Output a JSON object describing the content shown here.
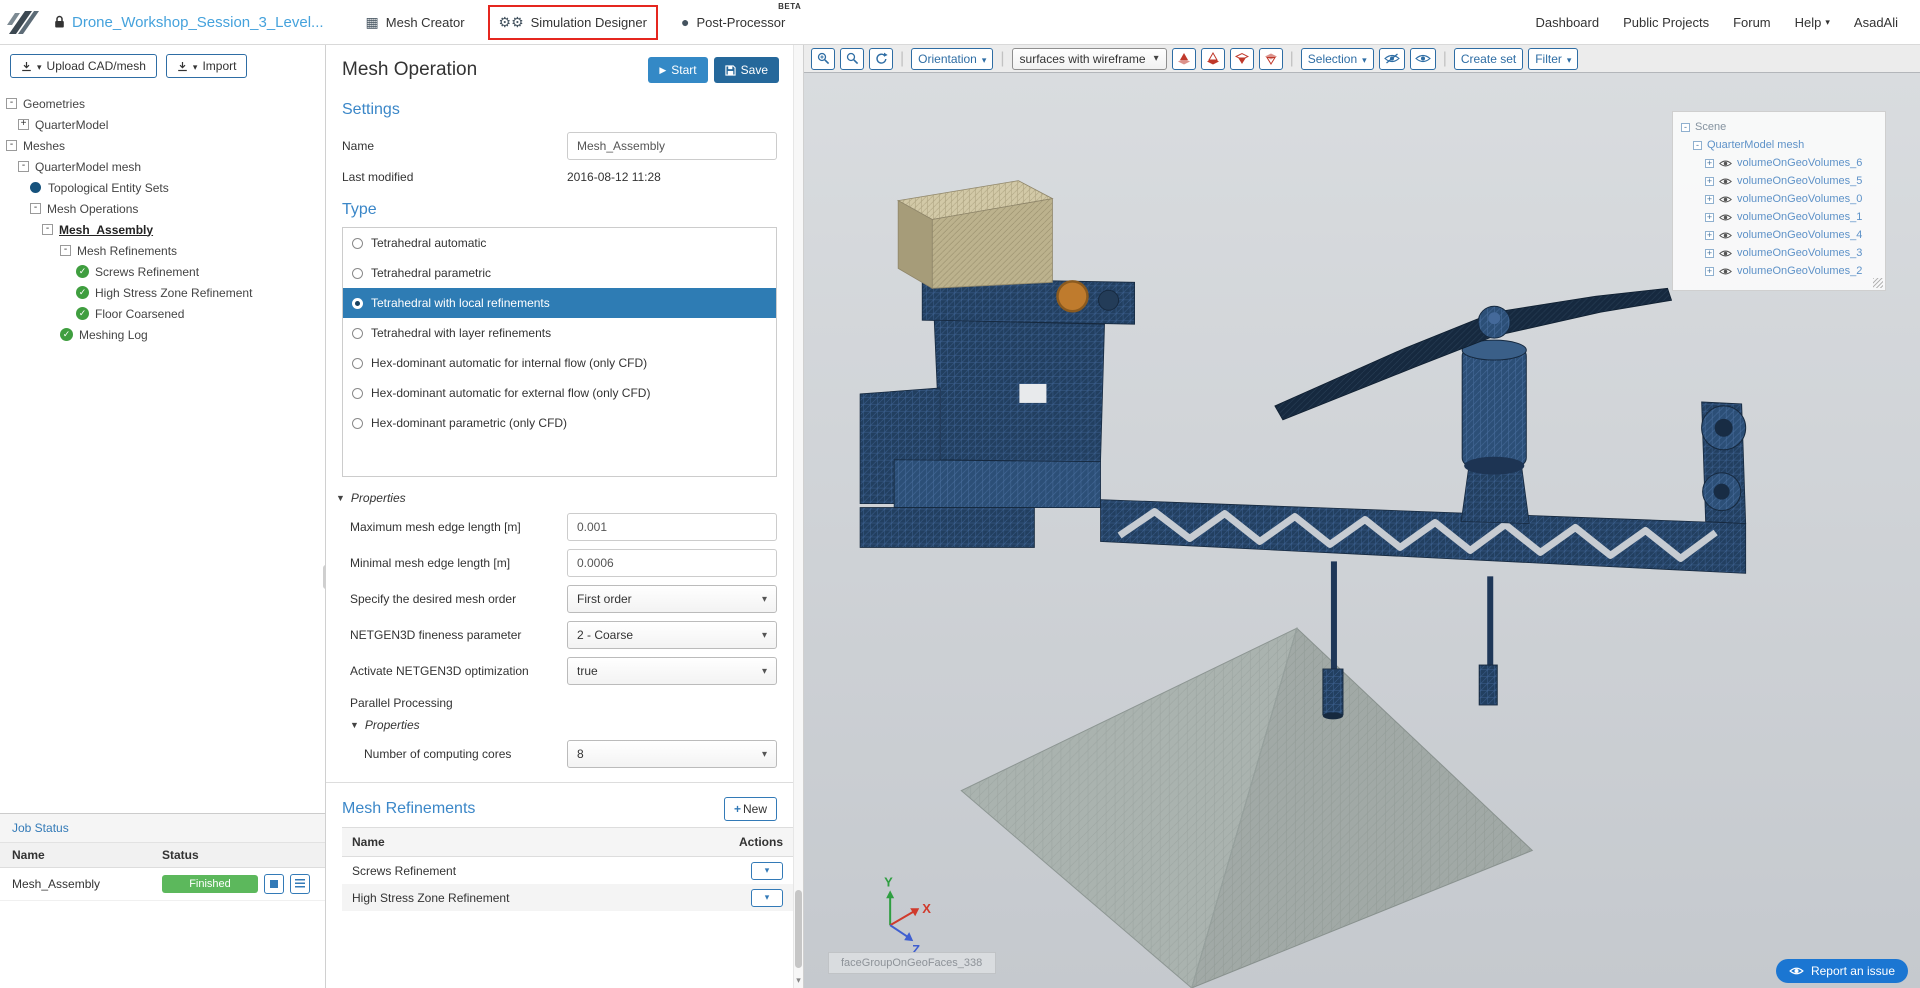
{
  "topbar": {
    "project_name": "Drone_Workshop_Session_3_Level...",
    "tabs": [
      {
        "label": "Mesh Creator",
        "icon": "grid-icon"
      },
      {
        "label": "Simulation Designer",
        "icon": "gears-icon",
        "annotated": true
      },
      {
        "label": "Post-Processor",
        "icon": "sphere-icon",
        "beta": "BETA"
      }
    ],
    "nav": {
      "dashboard": "Dashboard",
      "public_projects": "Public Projects",
      "forum": "Forum",
      "help": "Help",
      "user": "AsadAli"
    }
  },
  "sidebar": {
    "upload_button": "Upload CAD/mesh",
    "import_button": "Import",
    "tree": [
      {
        "label": "Geometries",
        "icon": "expander-open"
      },
      {
        "label": "QuarterModel",
        "icon": "expander-closed"
      },
      {
        "label": "Meshes",
        "icon": "expander-open"
      },
      {
        "label": "QuarterModel mesh",
        "icon": "expander-open"
      },
      {
        "label": "Topological Entity Sets",
        "icon": "blue-dot"
      },
      {
        "label": "Mesh Operations",
        "icon": "expander-open"
      },
      {
        "label": "Mesh_Assembly",
        "icon": "expander-open",
        "selected": true
      },
      {
        "label": "Mesh Refinements",
        "icon": "expander-open"
      },
      {
        "label": "Screws Refinement",
        "icon": "check-circle"
      },
      {
        "label": "High Stress Zone Refinement",
        "icon": "check-circle"
      },
      {
        "label": "Floor Coarsened",
        "icon": "check-circle"
      },
      {
        "label": "Meshing Log",
        "icon": "check-circle"
      }
    ],
    "job_status": {
      "title": "Job Status",
      "col_name": "Name",
      "col_status": "Status",
      "rows": [
        {
          "name": "Mesh_Assembly",
          "status": "Finished"
        }
      ]
    }
  },
  "panel": {
    "title": "Mesh Operation",
    "start_button": "Start",
    "save_button": "Save",
    "settings": {
      "heading": "Settings",
      "name_label": "Name",
      "name_value": "Mesh_Assembly",
      "modified_label": "Last modified",
      "modified_value": "2016-08-12 11:28"
    },
    "type": {
      "heading": "Type",
      "selected": "Tetrahedral with local refinements",
      "options": [
        "Tetrahedral automatic",
        "Tetrahedral parametric",
        "Tetrahedral with local refinements",
        "Tetrahedral with layer refinements",
        "Hex-dominant automatic for internal flow (only CFD)",
        "Hex-dominant automatic for external flow (only CFD)",
        "Hex-dominant parametric (only CFD)"
      ]
    },
    "properties": {
      "heading": "Properties",
      "fields": [
        {
          "label": "Maximum mesh edge length [m]",
          "value": "0.001"
        },
        {
          "label": "Minimal mesh edge length [m]",
          "value": "0.0006"
        },
        {
          "label": "Specify the desired mesh order",
          "value": "First order"
        },
        {
          "label": "NETGEN3D fineness parameter",
          "value": "2 - Coarse"
        },
        {
          "label": "Activate NETGEN3D optimization",
          "value": "true"
        }
      ],
      "parallel_label": "Parallel Processing",
      "nested_heading": "Properties",
      "cores_label": "Number of computing cores",
      "cores_value": "8"
    },
    "refinements": {
      "heading": "Mesh Refinements",
      "new_button": "New",
      "col_name": "Name",
      "col_actions": "Actions",
      "rows": [
        "Screws Refinement",
        "High Stress Zone Refinement"
      ]
    }
  },
  "viewport": {
    "toolbar": {
      "orientation": "Orientation",
      "render_mode": "surfaces with wireframe",
      "selection": "Selection",
      "create_set": "Create set",
      "filter": "Filter",
      "icons": [
        "zoom-in-icon",
        "zoom-fit-icon",
        "refresh-icon",
        "clip-plane-icons",
        "eye-off-icon",
        "eye-icon"
      ]
    },
    "scene_tree": {
      "root": "Scene",
      "mesh": "QuarterModel mesh",
      "volumes": [
        "volumeOnGeoVolumes_6",
        "volumeOnGeoVolumes_5",
        "volumeOnGeoVolumes_0",
        "volumeOnGeoVolumes_1",
        "volumeOnGeoVolumes_4",
        "volumeOnGeoVolumes_3",
        "volumeOnGeoVolumes_2"
      ]
    },
    "axis": {
      "x": "X",
      "y": "Y",
      "z": "Z"
    },
    "face_label": "faceGroupOnGeoFaces_338",
    "report_button": "Report an issue"
  },
  "colors": {
    "accent_blue": "#337ab7",
    "selected_row_blue": "#2e7cb4",
    "success_green": "#5cb85c",
    "annotation_red": "#e5261f",
    "link_blue": "#5e92c8",
    "mesh_navy": "#223f60",
    "floor_gray": "#aab3af"
  }
}
